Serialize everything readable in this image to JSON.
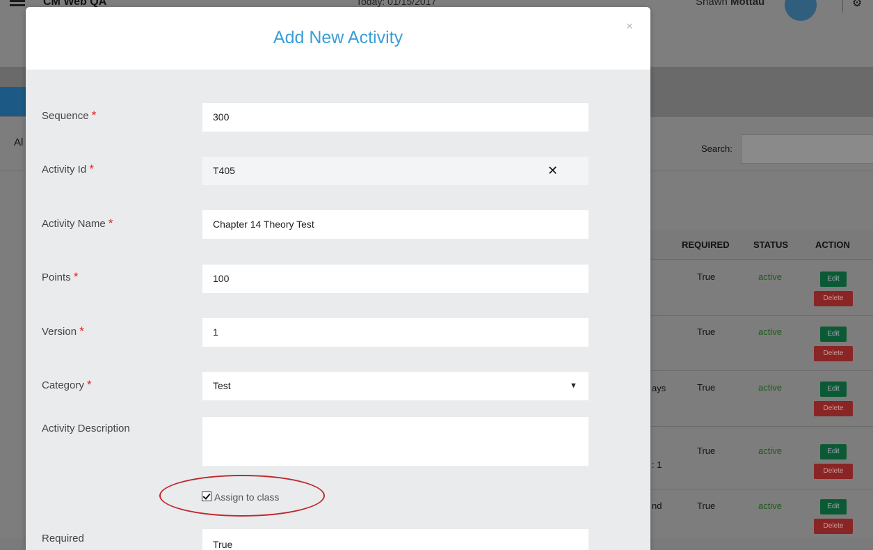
{
  "background": {
    "app_title": "CM Web QA",
    "date_text": "Today: 01/15/2017",
    "user_first": "Shawn",
    "user_last": "Mottau",
    "all_label": "Al",
    "search_label": "Search:",
    "table": {
      "headers": [
        "REQUIRED",
        "STATUS",
        "ACTION"
      ],
      "rows": [
        {
          "frag": "",
          "required": "True",
          "status": "active",
          "edit": "Edit",
          "delete": "Delete"
        },
        {
          "frag": "",
          "required": "True",
          "status": "active",
          "edit": "Edit",
          "delete": "Delete"
        },
        {
          "frag": "ays",
          "required": "True",
          "status": "active",
          "edit": "Edit",
          "delete": "Delete"
        },
        {
          "frag": ": 1",
          "required": "True",
          "status": "active",
          "edit": "Edit",
          "delete": "Delete"
        },
        {
          "frag": "nd",
          "required": "True",
          "status": "active",
          "edit": "Edit",
          "delete": "Delete"
        }
      ]
    }
  },
  "modal": {
    "title": "Add New Activity",
    "close_glyph": "×",
    "required_mark": "*",
    "fields": {
      "sequence": {
        "label": "Sequence",
        "value": "300"
      },
      "activity_id": {
        "label": "Activity Id",
        "value": "T405"
      },
      "activity_name": {
        "label": "Activity Name",
        "value": "Chapter 14 Theory Test"
      },
      "points": {
        "label": "Points",
        "value": "100"
      },
      "version": {
        "label": "Version",
        "value": "1"
      },
      "category": {
        "label": "Category",
        "value": "Test"
      },
      "activity_description": {
        "label": "Activity Description",
        "value": ""
      },
      "assign_to_class": {
        "label": "Assign to class",
        "checked": true
      },
      "required": {
        "label": "Required",
        "value": "True"
      }
    }
  },
  "colors": {
    "title_blue": "#3a9ed6",
    "required_red": "#e02020",
    "highlight_red": "#c0272d"
  }
}
